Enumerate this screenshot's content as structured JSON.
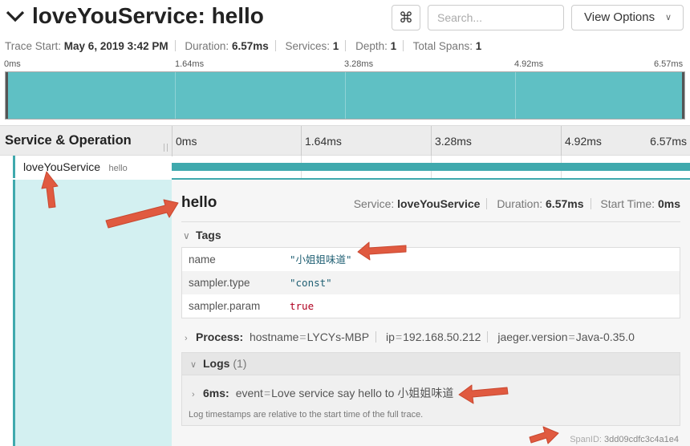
{
  "header": {
    "title": "loveYouService: hello",
    "command_icon": "⌘",
    "search_placeholder": "Search...",
    "view_options_label": "View Options"
  },
  "trace_meta": {
    "trace_start_label": "Trace Start:",
    "trace_start_value": "May 6, 2019 3:42 PM",
    "duration_label": "Duration:",
    "duration_value": "6.57ms",
    "services_label": "Services:",
    "services_value": "1",
    "depth_label": "Depth:",
    "depth_value": "1",
    "total_spans_label": "Total Spans:",
    "total_spans_value": "1"
  },
  "timeline": {
    "ticks": [
      "0ms",
      "1.64ms",
      "3.28ms",
      "4.92ms",
      "6.57ms"
    ]
  },
  "table_header": {
    "service_operation_label": "Service & Operation"
  },
  "span": {
    "service": "loveYouService",
    "operation": "hello"
  },
  "span_detail": {
    "operation": "hello",
    "service_label": "Service:",
    "service_value": "loveYouService",
    "duration_label": "Duration:",
    "duration_value": "6.57ms",
    "start_time_label": "Start Time:",
    "start_time_value": "0ms",
    "tags_label": "Tags",
    "tags": [
      {
        "key": "name",
        "value": "\"小姐姐味道\""
      },
      {
        "key": "sampler.type",
        "value": "\"const\""
      },
      {
        "key": "sampler.param",
        "value": "true"
      }
    ],
    "process_label": "Process:",
    "process": [
      {
        "key": "hostname",
        "value": "LYCYs-MBP"
      },
      {
        "key": "ip",
        "value": "192.168.50.212"
      },
      {
        "key": "jaeger.version",
        "value": "Java-0.35.0"
      }
    ],
    "logs_label": "Logs",
    "logs_count": "(1)",
    "log_entry": {
      "time": "6ms:",
      "key": "event",
      "value": "Love service say hello to 小姐姐味道"
    },
    "logs_note": "Log timestamps are relative to the start time of the full trace.",
    "span_id_label": "SpanID:",
    "span_id_value": "3dd09cdfc3c4a1e4"
  },
  "colors": {
    "accent": "#3fa9ad",
    "minimap_fill": "#5fc0c4",
    "detail_left_bg": "#d3f0f1",
    "annotation_arrow": "#e05a40"
  }
}
